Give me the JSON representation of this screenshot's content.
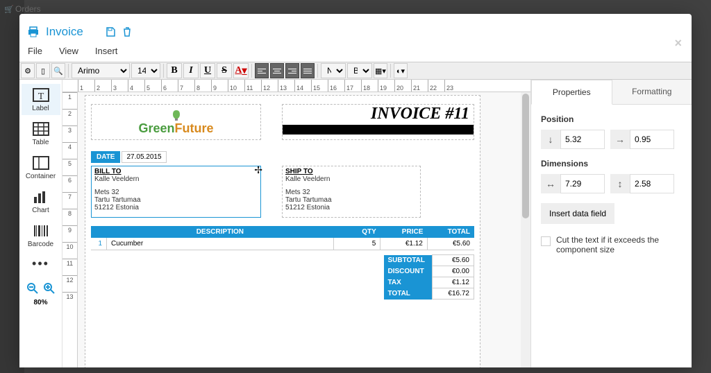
{
  "background": {
    "orders": "Orders"
  },
  "header": {
    "title": "Invoice"
  },
  "menubar": [
    "File",
    "View",
    "Insert"
  ],
  "toolbar": {
    "font": "Arimo",
    "fontsize": "14",
    "dropdown_a": "None",
    "dropdown_b": "Bord",
    "format": {
      "b": "B",
      "i": "I",
      "u": "U",
      "s": "S",
      "a": "A"
    }
  },
  "h_ruler": [
    "1",
    "2",
    "3",
    "4",
    "5",
    "6",
    "7",
    "8",
    "9",
    "10",
    "11",
    "12",
    "13",
    "14",
    "15",
    "16",
    "17",
    "18",
    "19",
    "20",
    "21",
    "22",
    "23"
  ],
  "v_ruler": [
    "1",
    "2",
    "3",
    "4",
    "5",
    "6",
    "7",
    "8",
    "9",
    "10",
    "11",
    "12",
    "13"
  ],
  "tools": {
    "label": "Label",
    "table": "Table",
    "container": "Container",
    "chart": "Chart",
    "barcode": "Barcode"
  },
  "zoom": "80%",
  "invoice": {
    "logo": {
      "green": "Green",
      "future": "Future"
    },
    "title": "INVOICE #11",
    "date_label": "DATE",
    "date_value": "27.05.2015",
    "billto_label": "BILL TO",
    "shipto_label": "SHIP TO",
    "billto": {
      "name": "Kalle Veeldern",
      "street": "Mets 32",
      "city": "Tartu Tartumaa",
      "zip": "51212 Estonia"
    },
    "shipto": {
      "name": "Kalle Veeldern",
      "street": "Mets 32",
      "city": "Tartu Tartumaa",
      "zip": "51212 Estonia"
    },
    "columns": {
      "desc": "DESCRIPTION",
      "qty": "QTY",
      "price": "PRICE",
      "total": "TOTAL"
    },
    "rows": [
      {
        "num": "1",
        "desc": "Cucumber",
        "qty": "5",
        "price": "€1.12",
        "total": "€5.60"
      }
    ],
    "totals": {
      "subtotal_label": "SUBTOTAL",
      "subtotal": "€5.60",
      "discount_label": "DISCOUNT",
      "discount": "€0.00",
      "tax_label": "TAX",
      "tax": "€1.12",
      "total_label": "TOTAL",
      "total": "€16.72"
    }
  },
  "panel": {
    "tab_properties": "Properties",
    "tab_formatting": "Formatting",
    "position_label": "Position",
    "pos_y": "5.32",
    "pos_x": "0.95",
    "dim_label": "Dimensions",
    "dim_w": "7.29",
    "dim_h": "2.58",
    "insert_btn": "Insert data field",
    "cut_text": "Cut the text if it exceeds the component size"
  }
}
